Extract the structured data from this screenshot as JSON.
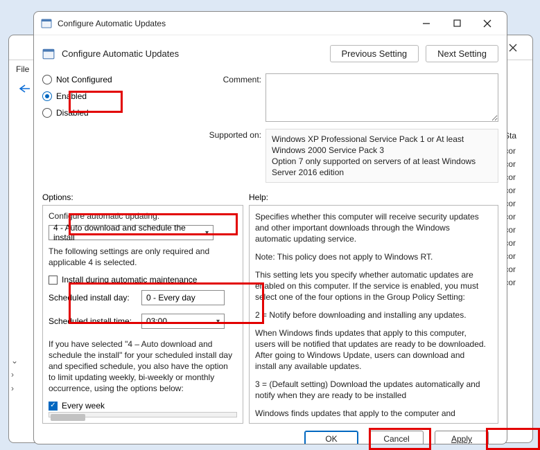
{
  "bg": {
    "file_menu": "File",
    "col_header": "Sta",
    "rows": [
      "ot cor",
      "ot cor",
      "ot cor",
      "ot cor",
      "ot cor",
      "ot cor",
      "ot cor",
      "ot cor",
      "ot cor",
      "ot cor",
      "ot cor"
    ]
  },
  "titlebar": {
    "title": "Configure Automatic Updates"
  },
  "header": {
    "policy_name": "Configure Automatic Updates",
    "prev": "Previous Setting",
    "next": "Next Setting"
  },
  "state": {
    "not_configured": "Not Configured",
    "enabled": "Enabled",
    "disabled": "Disabled"
  },
  "labels": {
    "comment": "Comment:",
    "supported": "Supported on:",
    "options": "Options:",
    "help": "Help:"
  },
  "supported_text": "Windows XP Professional Service Pack 1 or At least Windows 2000 Service Pack 3\nOption 7 only supported on servers of at least Windows Server 2016 edition",
  "supported_lines": {
    "l1": "Windows XP Professional Service Pack 1 or At least Windows 2000 Service Pack 3",
    "l2": "Option 7 only supported on servers of at least Windows Server 2016 edition"
  },
  "options": {
    "configure_label": "Configure automatic updating:",
    "configure_value": "4 - Auto download and schedule the install",
    "only_required_para": "The following settings are only required and applicable 4 is selected.",
    "install_maint": "Install during automatic maintenance",
    "sched_day_label": "Scheduled install day:",
    "sched_day_value": "0 - Every day",
    "sched_time_label": "Scheduled install time:",
    "sched_time_value": "03:00",
    "long_para": "If you have selected \"4 – Auto download and schedule the install\" for your scheduled install day and specified schedule, you also have the option to limit updating weekly, bi-weekly or monthly occurrence, using the options below:",
    "every_week": "Every week"
  },
  "help": {
    "p1": "Specifies whether this computer will receive security updates and other important downloads through the Windows automatic updating service.",
    "p2": "Note: This policy does not apply to Windows RT.",
    "p3": "This setting lets you specify whether automatic updates are enabled on this computer. If the service is enabled, you must select one of the four options in the Group Policy Setting:",
    "p4": "2 = Notify before downloading and installing any updates.",
    "p5": "When Windows finds updates that apply to this computer, users will be notified that updates are ready to be downloaded. After going to Windows Update, users can download and install any available updates.",
    "p6": "3 = (Default setting) Download the updates automatically and notify when they are ready to be installed",
    "p7": "Windows finds updates that apply to the computer and"
  },
  "buttons": {
    "ok": "OK",
    "cancel": "Cancel",
    "apply": "Apply"
  }
}
